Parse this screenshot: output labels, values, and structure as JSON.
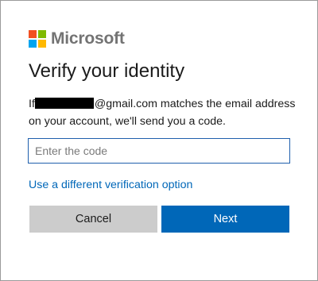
{
  "brand": {
    "name": "Microsoft",
    "logo_colors": [
      "#f25022",
      "#7fba00",
      "#00a4ef",
      "#ffb900"
    ],
    "logo_icon": "microsoft-four-squares"
  },
  "title": "Verify your identity",
  "description": {
    "prefix": "If",
    "email_suffix": "@gmail.com",
    "rest": " matches the email address on your account, we'll send you a code."
  },
  "code_field": {
    "placeholder": "Enter the code",
    "value": ""
  },
  "alternate_link": "Use a different verification option",
  "buttons": {
    "cancel": "Cancel",
    "next": "Next"
  },
  "colors": {
    "accent": "#0067b8",
    "cancel_bg": "#cccccc",
    "input_border": "#1f5fad"
  }
}
